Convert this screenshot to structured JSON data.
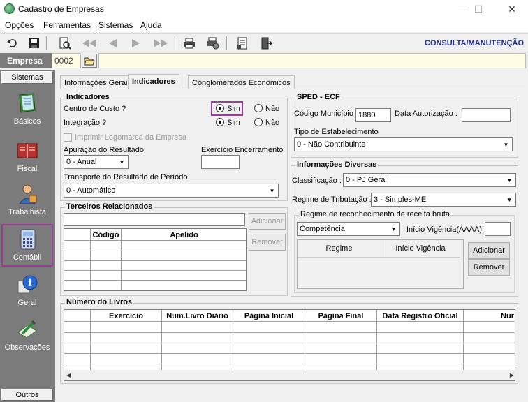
{
  "window": {
    "title": "Cadastro de Empresas",
    "minimize": "—",
    "maximize": "☐",
    "close": "✕"
  },
  "menu": [
    "Opções",
    "Ferramentas",
    "Sistemas",
    "Ajuda"
  ],
  "toolbar": {
    "mode_label": "CONSULTA/MANUTENÇÃO",
    "icons": [
      "undo-icon",
      "save-icon",
      "preview-icon",
      "first-icon",
      "prev-icon",
      "next-icon",
      "last-icon",
      "print-icon",
      "print-setup-icon",
      "report-icon",
      "exit-icon"
    ]
  },
  "empresa": {
    "label": "Empresa",
    "code": "0002",
    "name": ""
  },
  "sidebar": {
    "header": "Sistemas",
    "items": [
      {
        "label": "Básicos",
        "icon": "book-icon"
      },
      {
        "label": "Fiscal",
        "icon": "fiscal-book-icon"
      },
      {
        "label": "Trabalhista",
        "icon": "worker-icon"
      },
      {
        "label": "Contábil",
        "icon": "calculator-icon"
      },
      {
        "label": "Geral",
        "icon": "info-icon"
      },
      {
        "label": "Observações",
        "icon": "notepad-icon"
      }
    ],
    "footer": "Outros"
  },
  "tabs": [
    "Informações Gerais",
    "Indicadores",
    "Conglomerados Econômicos"
  ],
  "indicadores": {
    "title": "Indicadores",
    "centro_custo_label": "Centro de Custo ?",
    "integracao_label": "Integração ?",
    "sim": "Sim",
    "nao": "Não",
    "imprimir_logo": "Imprimir Logomarca da Empresa",
    "apuracao_label": "Apuração do Resultado",
    "apuracao_value": "0 - Anual",
    "exercicio_label": "Exercício Encerramento",
    "exercicio_value": "",
    "transporte_label": "Transporte do Resultado de Período",
    "transporte_value": "0 - Automático"
  },
  "terceiros": {
    "title": "Terceiros Relacionados",
    "columns": [
      "Código",
      "Apelido"
    ],
    "add": "Adicionar",
    "remove": "Remover"
  },
  "sped": {
    "title": "SPED - ECF",
    "cod_municipio_label": "Código Município :",
    "cod_municipio_value": "1880",
    "data_autorizacao_label": "Data Autorização :",
    "data_autorizacao_value": "",
    "tipo_label": "Tipo de Estabelecimento",
    "tipo_value": "0 - Não Contribuinte"
  },
  "diversas": {
    "title": "Informações Diversas",
    "classificacao_label": "Classificação :",
    "classificacao_value": "0 - PJ Geral",
    "regime_label": "Regime de Tributação :",
    "regime_value": "3 - Simples-ME"
  },
  "receita": {
    "title": "Regime de reconhecimento de receita bruta",
    "select_value": "Competência",
    "inicio_label": "Início Vigência(AAAA):",
    "inicio_value": "",
    "columns": [
      "Regime",
      "Início Vigência"
    ],
    "add": "Adicionar",
    "remove": "Remover"
  },
  "livros": {
    "title": "Número do Livros",
    "columns": [
      "Exercício",
      "Num.Livro Diário",
      "Página Inicial",
      "Página Final",
      "Data Registro Oficial",
      "Nur"
    ]
  }
}
